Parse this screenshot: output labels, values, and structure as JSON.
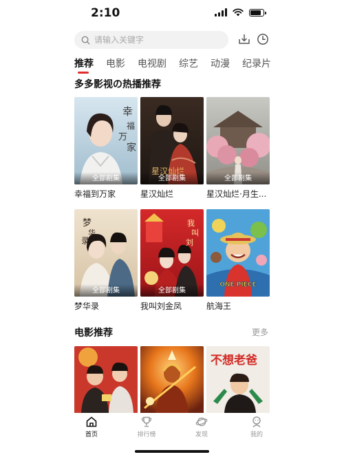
{
  "status_bar": {
    "time": "2:10",
    "battery_level": 0.85
  },
  "search": {
    "placeholder": "请输入关键字"
  },
  "top_icons": [
    "download-icon",
    "history-icon"
  ],
  "tabs": [
    {
      "label": "推荐",
      "active": true
    },
    {
      "label": "电影",
      "active": false
    },
    {
      "label": "电视剧",
      "active": false
    },
    {
      "label": "综艺",
      "active": false
    },
    {
      "label": "动漫",
      "active": false
    },
    {
      "label": "纪录片",
      "active": false
    }
  ],
  "hot_section": {
    "title": "多多影视の热播推荐",
    "items": [
      {
        "title": "幸福到万家",
        "badge": "全部剧集",
        "poster_text": "幸福到万家"
      },
      {
        "title": "星汉灿烂",
        "badge": "全部剧集",
        "poster_text": "星汉灿烂"
      },
      {
        "title": "星汉灿烂·月生...",
        "badge": "全部剧集",
        "poster_text": ""
      },
      {
        "title": "梦华录",
        "badge": "全部剧集",
        "poster_text": "梦华录"
      },
      {
        "title": "我叫刘金凤",
        "badge": "全部剧集",
        "poster_text": "我叫刘金凤"
      },
      {
        "title": "航海王",
        "badge": "",
        "poster_text": "ONE PIECE"
      }
    ]
  },
  "movie_section": {
    "title": "电影推荐",
    "more_label": "更多",
    "posters": [
      {
        "poster_text": ""
      },
      {
        "poster_text": ""
      },
      {
        "poster_text": "不想老爸"
      }
    ]
  },
  "bottom_nav": [
    {
      "label": "首页",
      "icon": "home-icon",
      "active": true
    },
    {
      "label": "排行榜",
      "icon": "trophy-icon",
      "active": false
    },
    {
      "label": "发现",
      "icon": "planet-icon",
      "active": false
    },
    {
      "label": "我的",
      "icon": "user-icon",
      "active": false
    }
  ],
  "colors": {
    "accent": "#e02c2c",
    "text": "#1c1c1c",
    "muted": "#999999",
    "search_bg": "#f2f2f2"
  }
}
